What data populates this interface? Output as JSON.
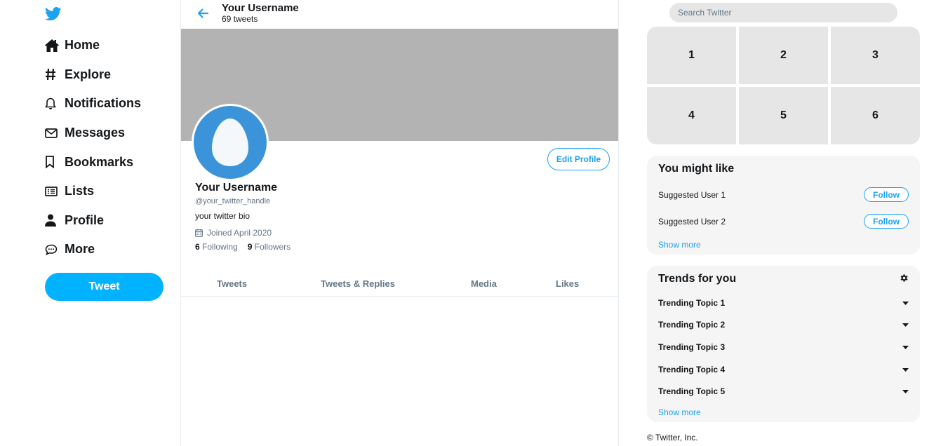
{
  "nav": {
    "items": [
      {
        "label": "Home",
        "icon": "home-icon"
      },
      {
        "label": "Explore",
        "icon": "hashtag-icon"
      },
      {
        "label": "Notifications",
        "icon": "bell-icon"
      },
      {
        "label": "Messages",
        "icon": "envelope-icon"
      },
      {
        "label": "Bookmarks",
        "icon": "bookmark-icon"
      },
      {
        "label": "Lists",
        "icon": "list-icon"
      },
      {
        "label": "Profile",
        "icon": "user-icon"
      },
      {
        "label": "More",
        "icon": "comment-dots-icon"
      }
    ],
    "tweet_label": "Tweet"
  },
  "header": {
    "name": "Your Username",
    "tweet_count": "69 tweets"
  },
  "profile": {
    "edit_label": "Edit Profile",
    "name": "Your Username",
    "handle": "@your_twitter_handle",
    "bio": "your twitter bio",
    "joined": "Joined April 2020",
    "following_count": "6",
    "following_label": "Following",
    "followers_count": "9",
    "followers_label": "Followers"
  },
  "tabs": [
    "Tweets",
    "Tweets & Replies",
    "Media",
    "Likes"
  ],
  "search": {
    "placeholder": "Search Twitter"
  },
  "media_grid": [
    "1",
    "2",
    "3",
    "4",
    "5",
    "6"
  ],
  "suggestions": {
    "title": "You might like",
    "users": [
      {
        "name": "Suggested User 1",
        "button": "Follow"
      },
      {
        "name": "Suggested User 2",
        "button": "Follow"
      }
    ],
    "show_more": "Show more"
  },
  "trends": {
    "title": "Trends for you",
    "items": [
      "Trending Topic 1",
      "Trending Topic 2",
      "Trending Topic 3",
      "Trending Topic 4",
      "Trending Topic 5"
    ],
    "show_more": "Show more"
  },
  "footer": "© Twitter, Inc.",
  "colors": {
    "accent": "#1da1f2",
    "tweet_button": "#00b2ff",
    "avatar": "#3b94d9",
    "banner": "#b3b3b3"
  }
}
